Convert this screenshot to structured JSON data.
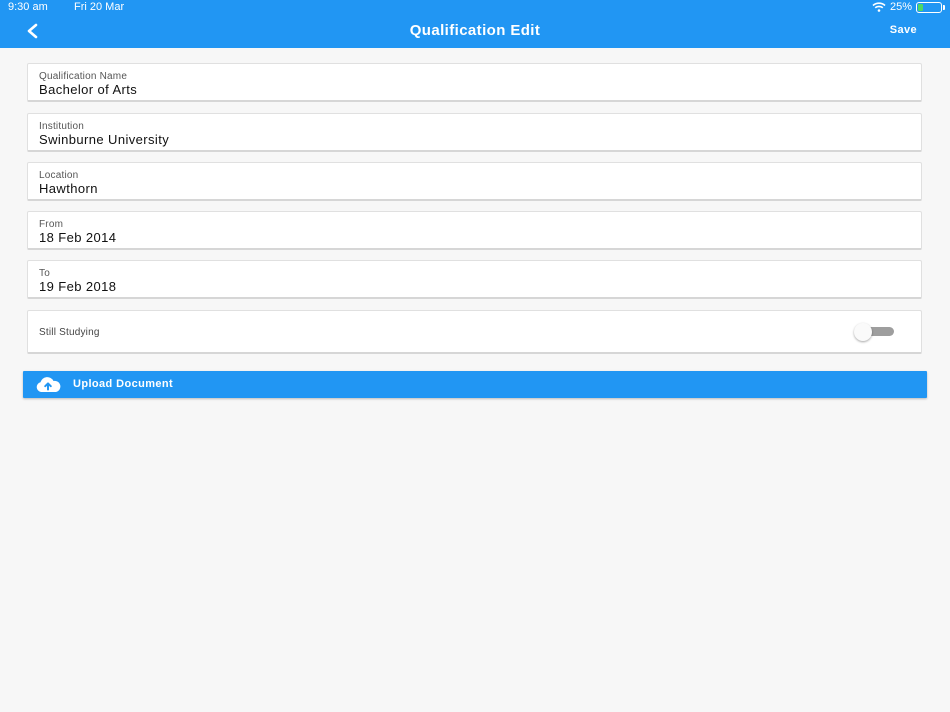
{
  "status_bar": {
    "time": "9:30 am",
    "date": "Fri 20 Mar",
    "battery_text": "25%",
    "battery_level": 0.25,
    "wifi_icon": "wifi-icon"
  },
  "nav": {
    "title": "Qualification Edit",
    "save_label": "Save",
    "back_icon": "chevron-left-icon",
    "color": "#2196f3"
  },
  "form": {
    "qualification_name": {
      "label": "Qualification Name",
      "value": "Bachelor of Arts"
    },
    "institution": {
      "label": "Institution",
      "value": "Swinburne University"
    },
    "location": {
      "label": "Location",
      "value": "Hawthorn"
    },
    "from": {
      "label": "From",
      "value": "18 Feb 2014"
    },
    "to": {
      "label": "To",
      "value": "19 Feb 2018"
    },
    "still_studying": {
      "label": "Still Studying",
      "checked": false
    }
  },
  "upload": {
    "label": "Upload Document",
    "icon": "cloud-upload-icon"
  }
}
